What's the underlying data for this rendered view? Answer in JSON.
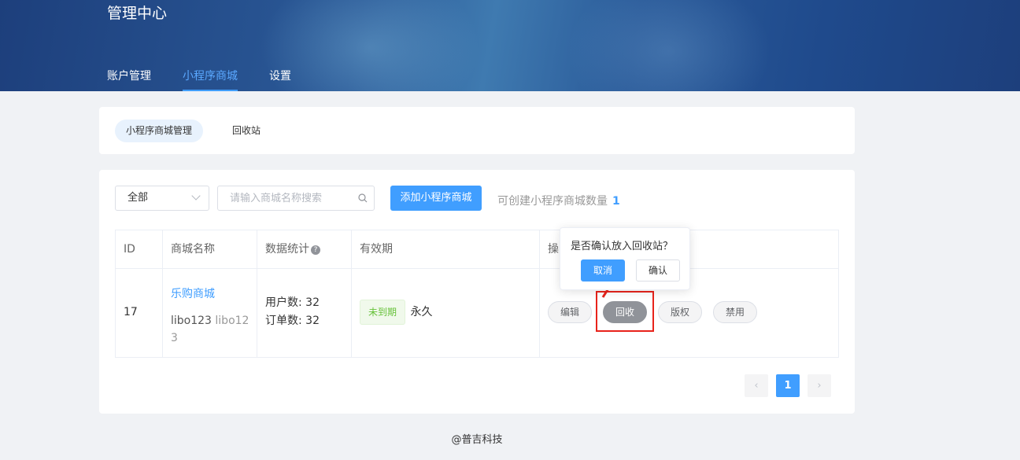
{
  "app": {
    "title": "管理中心"
  },
  "nav": {
    "items": [
      "账户管理",
      "小程序商城",
      "设置"
    ],
    "active_index": 1
  },
  "subtabs": {
    "manage": "小程序商城管理",
    "recycle": "回收站"
  },
  "filter": {
    "select_value": "全部",
    "search_placeholder": "请输入商城名称搜索",
    "add_button": "添加小程序商城",
    "quota_label": "可创建小程序商城数量",
    "quota_value": "1"
  },
  "table": {
    "columns": [
      "ID",
      "商城名称",
      "数据统计",
      "有效期",
      "操"
    ],
    "rows": [
      {
        "id": "17",
        "shop_name": "乐购商城",
        "account": "libo123",
        "account_alias": "libo123",
        "users": "用户数: 32",
        "orders": "订单数: 32",
        "expire_tag": "未到期",
        "expire_value": "永久",
        "actions": [
          "编辑",
          "回收",
          "版权",
          "禁用"
        ]
      }
    ]
  },
  "popover": {
    "message": "是否确认放入回收站？",
    "cancel": "取消",
    "confirm": "确认"
  },
  "pagination": {
    "current": "1",
    "prev": "‹",
    "next": "›"
  },
  "footer": {
    "text": "@普吉科技"
  },
  "colors": {
    "primary": "#409eff",
    "success": "#67c23a",
    "annotation": "#e8231b",
    "header_dark": "#1d3f7c"
  }
}
